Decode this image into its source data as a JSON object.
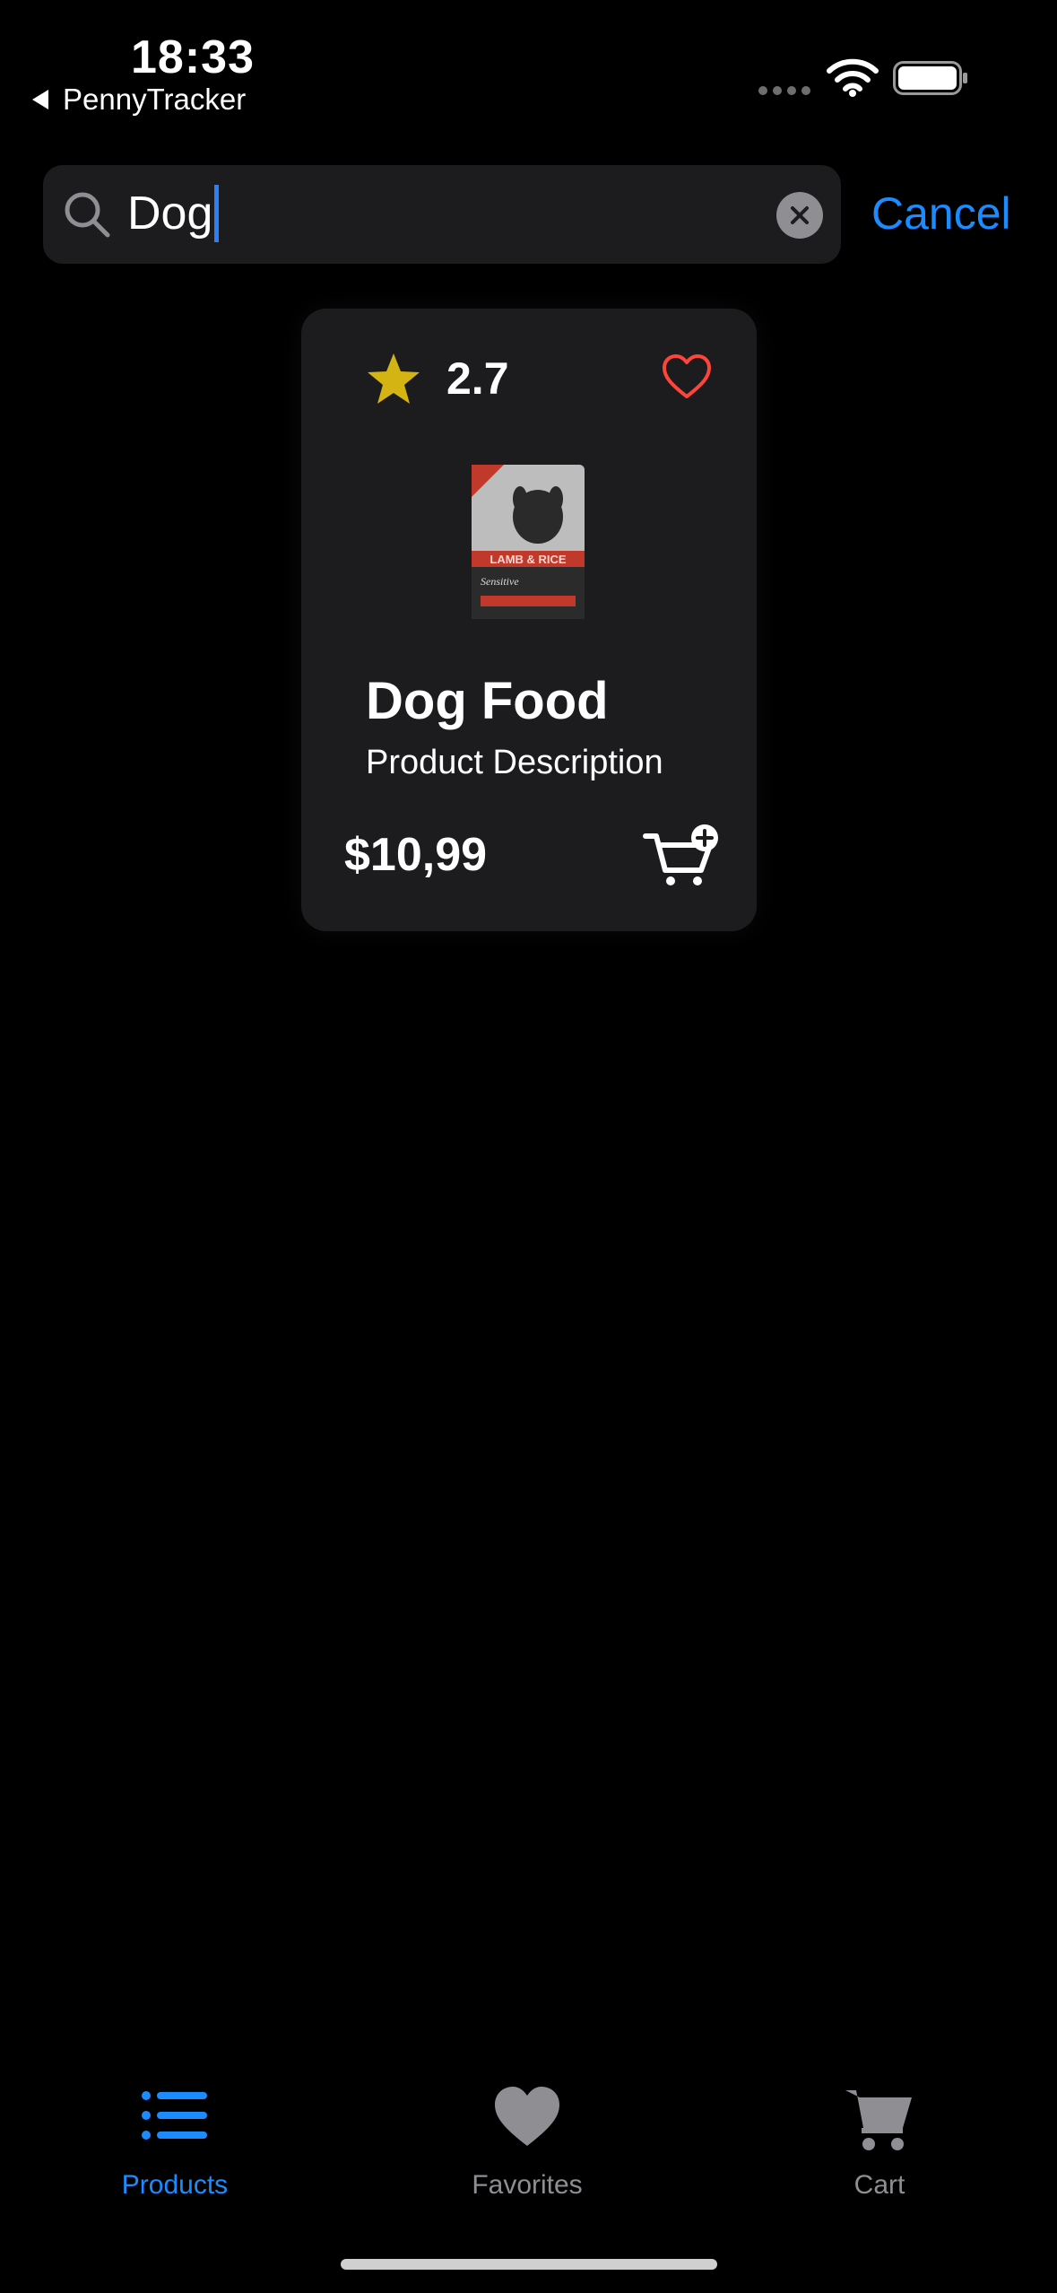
{
  "status_bar": {
    "time": "18:33",
    "back_app": "PennyTracker"
  },
  "search": {
    "query": "Dog",
    "cancel_label": "Cancel"
  },
  "product": {
    "rating": "2.7",
    "name": "Dog Food",
    "description": "Product Description",
    "price": "$10,99",
    "image_text": [
      "LAMB & RICE",
      "Sensitive"
    ]
  },
  "tab_bar": {
    "items": [
      {
        "label": "Products",
        "icon": "list-icon",
        "active": true
      },
      {
        "label": "Favorites",
        "icon": "heart-icon",
        "active": false
      },
      {
        "label": "Cart",
        "icon": "cart-icon",
        "active": false
      }
    ]
  },
  "colors": {
    "background": "#000000",
    "card": "#1c1c1e",
    "accent_blue": "#1a8cff",
    "star_yellow": "#d4b412",
    "heart_red": "#ff453a",
    "inactive_gray": "#8e8e93"
  }
}
